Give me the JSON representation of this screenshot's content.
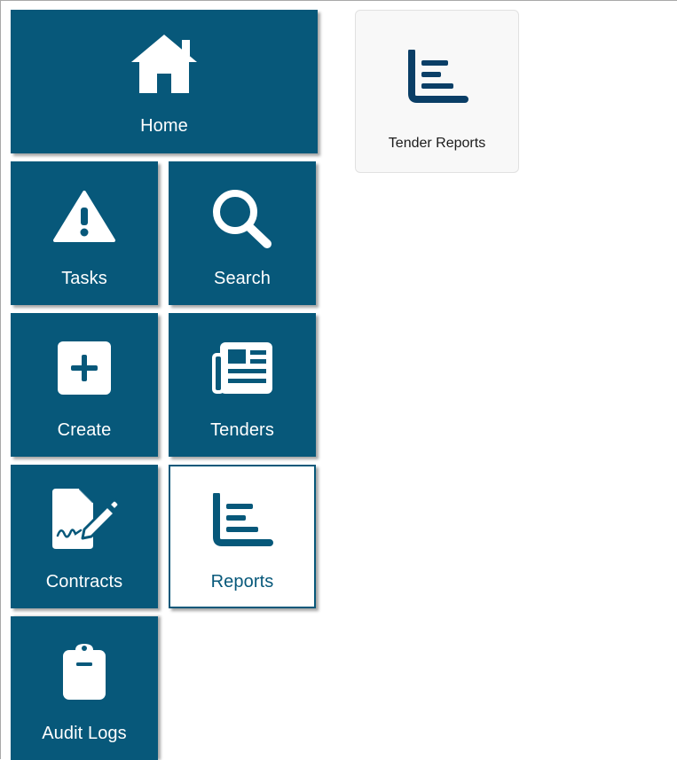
{
  "nav": {
    "home": {
      "label": "Home",
      "icon": "home-icon"
    },
    "tasks": {
      "label": "Tasks",
      "icon": "warning-icon"
    },
    "search": {
      "label": "Search",
      "icon": "search-icon"
    },
    "create": {
      "label": "Create",
      "icon": "plus-square-icon"
    },
    "tenders": {
      "label": "Tenders",
      "icon": "newspaper-icon"
    },
    "contracts": {
      "label": "Contracts",
      "icon": "file-signature-icon"
    },
    "reports": {
      "label": "Reports",
      "icon": "chart-bar-icon",
      "active": true
    },
    "audit_logs": {
      "label": "Audit Logs",
      "icon": "clipboard-icon"
    }
  },
  "submenu": {
    "items": [
      {
        "label": "Tender Reports",
        "icon": "chart-bar-icon"
      }
    ]
  },
  "colors": {
    "tile_bg": "#07587a",
    "tile_text": "#ffffff",
    "active_tile_bg": "#ffffff",
    "card_bg": "#f8f8f8"
  }
}
